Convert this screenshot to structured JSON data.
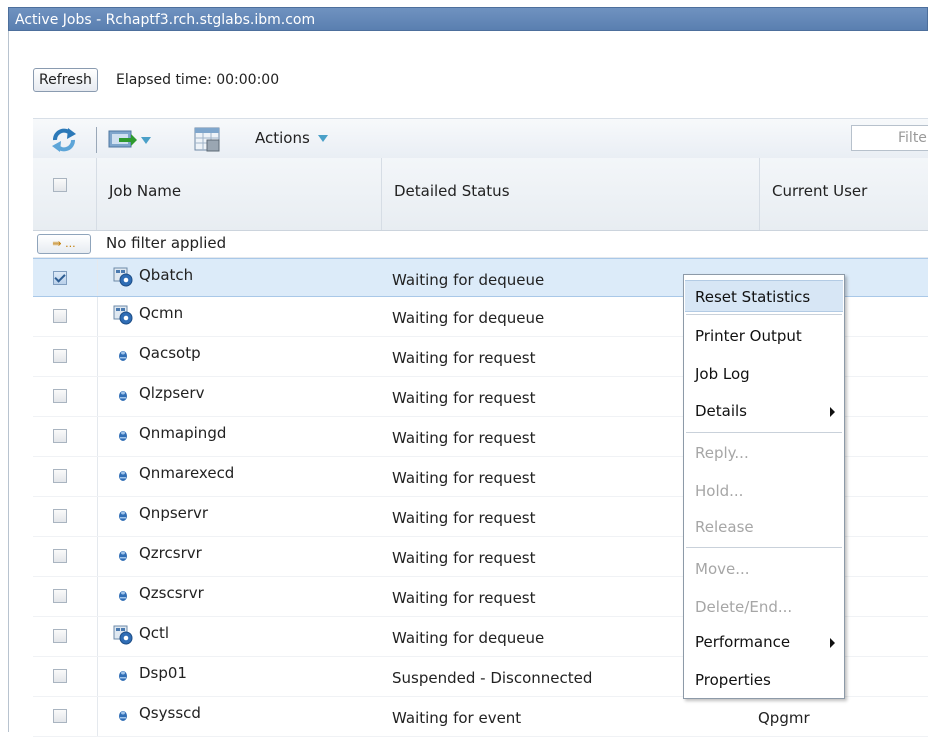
{
  "window": {
    "title": "Active Jobs - Rchaptf3.rch.stglabs.ibm.com"
  },
  "controls": {
    "refresh_label": "Refresh",
    "elapsed_label": "Elapsed time: 00:00:00"
  },
  "toolbar": {
    "icons": [
      "refresh-icon",
      "export-icon",
      "table-config-icon"
    ],
    "actions_label": "Actions",
    "filter_placeholder": "Filter"
  },
  "table": {
    "columns": [
      "Job Name",
      "Detailed Status",
      "Current User"
    ],
    "filter_button_label": "⇛ ...",
    "filter_status": "No filter applied",
    "rows": [
      {
        "name": "Qbatch",
        "status": "Waiting for dequeue",
        "user": "",
        "icon": "subsystem-icon",
        "checked": true
      },
      {
        "name": "Qcmn",
        "status": "Waiting for dequeue",
        "user": "",
        "icon": "subsystem-icon",
        "checked": false
      },
      {
        "name": "Qacsotp",
        "status": "Waiting for request",
        "user": "",
        "icon": "job-icon",
        "checked": false
      },
      {
        "name": "Qlzpserv",
        "status": "Waiting for request",
        "user": "",
        "icon": "job-icon",
        "checked": false
      },
      {
        "name": "Qnmapingd",
        "status": "Waiting for request",
        "user": "",
        "icon": "job-icon",
        "checked": false
      },
      {
        "name": "Qnmarexecd",
        "status": "Waiting for request",
        "user": "",
        "icon": "job-icon",
        "checked": false
      },
      {
        "name": "Qnpservr",
        "status": "Waiting for request",
        "user": "",
        "icon": "job-icon",
        "checked": false
      },
      {
        "name": "Qzrcsrvr",
        "status": "Waiting for request",
        "user": "",
        "icon": "job-icon",
        "checked": false
      },
      {
        "name": "Qzscsrvr",
        "status": "Waiting for request",
        "user": "",
        "icon": "job-icon",
        "checked": false
      },
      {
        "name": "Qctl",
        "status": "Waiting for dequeue",
        "user": "",
        "icon": "subsystem-icon",
        "checked": false
      },
      {
        "name": "Dsp01",
        "status": "Suspended - Disconnected",
        "user": "",
        "icon": "job-icon",
        "checked": false
      },
      {
        "name": "Qsysscd",
        "status": "Waiting for event",
        "user": "Qpgmr",
        "icon": "job-icon",
        "checked": false
      }
    ]
  },
  "context_menu": {
    "items": [
      {
        "label": "Reset Statistics",
        "state": "highlighted"
      },
      {
        "label": "Printer Output",
        "state": "enabled"
      },
      {
        "label": "Job Log",
        "state": "enabled"
      },
      {
        "label": "Details",
        "state": "enabled",
        "submenu": true
      },
      {
        "label": "Reply...",
        "state": "disabled"
      },
      {
        "label": "Hold...",
        "state": "disabled"
      },
      {
        "label": "Release",
        "state": "disabled"
      },
      {
        "label": "Move...",
        "state": "disabled"
      },
      {
        "label": "Delete/End...",
        "state": "disabled"
      },
      {
        "label": "Performance",
        "state": "enabled",
        "submenu": true
      },
      {
        "label": "Properties",
        "state": "enabled"
      }
    ]
  },
  "colors": {
    "title_bar": "#5a7fb0",
    "selection": "#dcebf9",
    "menu_highlight": "#d7e6f5",
    "accent_triangle": "#4aa0c8"
  }
}
